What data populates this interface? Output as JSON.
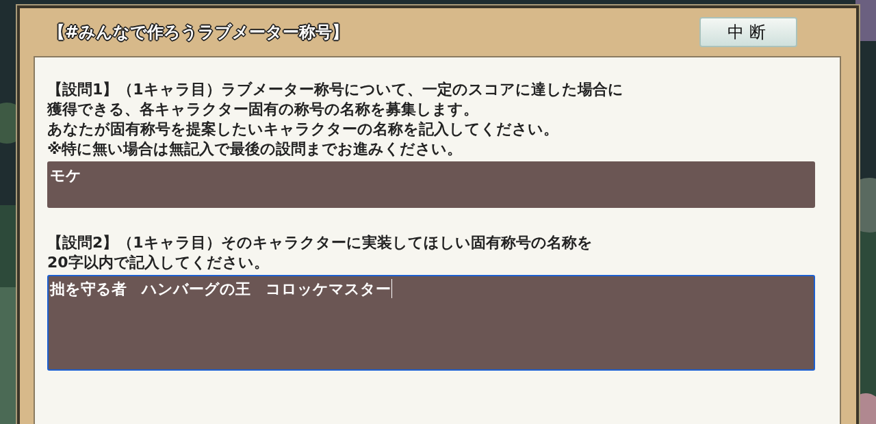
{
  "dialog": {
    "title": "【#みんなで作ろうラブメーター称号】",
    "button": "中断"
  },
  "questions": [
    {
      "lines": [
        "【設問1】（1キャラ目）ラブメーター称号について、一定のスコアに達した場合に",
        "獲得できる、各キャラクター固有の称号の名称を募集します。",
        "あなたが固有称号を提案したいキャラクターの名称を記入してください。",
        "※特に無い場合は無記入で最後の設問までお進みください。"
      ],
      "answer": {
        "value": "モケ",
        "focused": false
      }
    },
    {
      "lines": [
        "【設問2】（1キャラ目）そのキャラクターに実装してほしい固有称号の名称を",
        "20字以内で記入してください。"
      ],
      "answer": {
        "value": "拙を守る者　ハンバーグの王　コロッケマスター",
        "focused": true
      }
    }
  ]
}
